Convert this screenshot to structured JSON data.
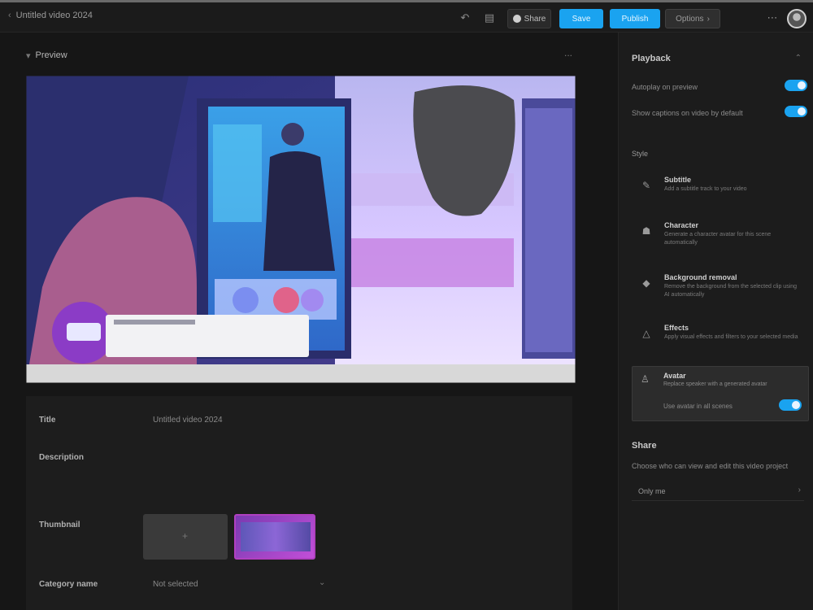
{
  "topbar": {
    "title": "Untitled video 2024",
    "share_label": "Share",
    "primary_label": "Save",
    "secondary_label": "Publish",
    "more_label": "Options",
    "chevron": "›"
  },
  "preview": {
    "title": "Preview",
    "more_icon": "..."
  },
  "details": {
    "title_label": "Title",
    "title_value": "Untitled video 2024",
    "description_label": "Description",
    "thumbnail_label": "Thumbnail",
    "category_label": "Category name",
    "category_value": "Not selected"
  },
  "sidebar": {
    "playback_title": "Playback",
    "toggle_1_label": "Autoplay on preview",
    "toggle_2_label": "Show captions on video by default",
    "generate_title": "Style",
    "items": [
      {
        "title": "Subtitle",
        "desc": "Add a subtitle track to your video"
      },
      {
        "title": "Character",
        "desc": "Generate a character avatar for this scene automatically"
      },
      {
        "title": "Background removal",
        "desc": "Remove the background from the selected clip using AI automatically"
      },
      {
        "title": "Effects",
        "desc": "Apply visual effects and filters to your selected media"
      },
      {
        "title": "Avatar",
        "desc": "Replace speaker with a generated avatar"
      }
    ],
    "selected_toggle_label": "Use avatar in all scenes",
    "share_title": "Share",
    "share_desc": "Choose who can view and edit this video project",
    "share_dropdown": "Only me"
  },
  "colors": {
    "accent": "#1aa3f0",
    "background": "#141414",
    "sidebar": "#1c1c1c"
  }
}
